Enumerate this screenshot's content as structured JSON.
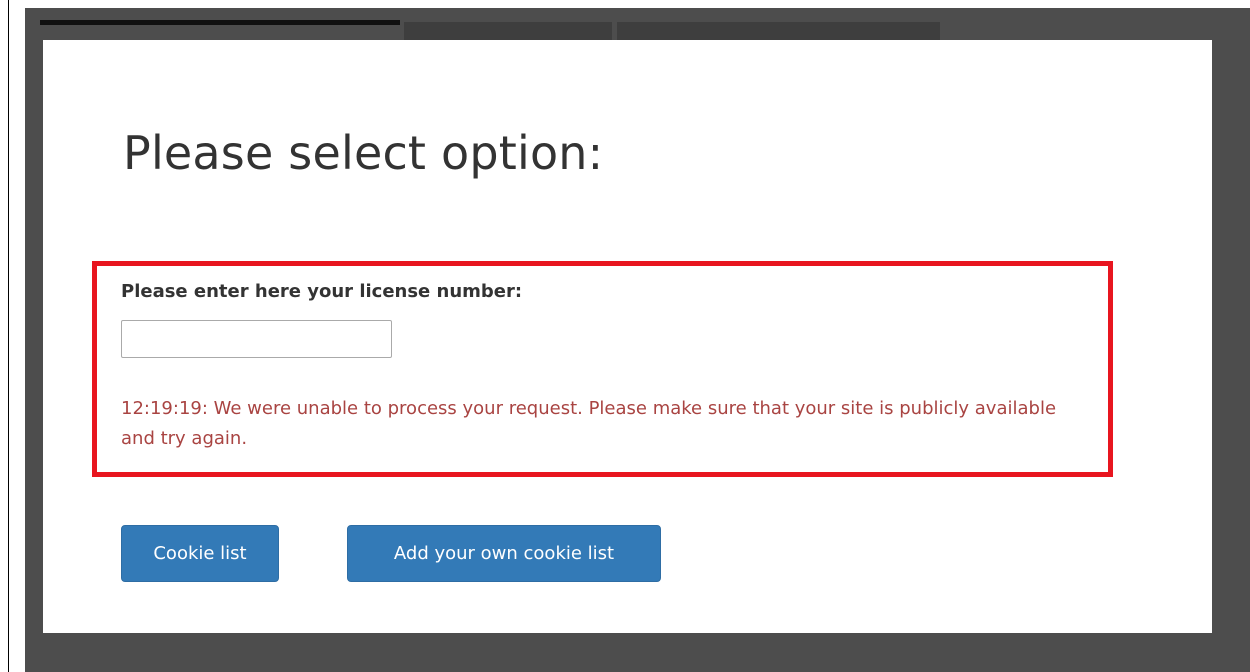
{
  "dialog": {
    "title": "Please select option:",
    "license": {
      "label": "Please enter here your license number:",
      "value": "",
      "placeholder": ""
    },
    "error_message": "12:19:19: We were unable to process your request. Please make sure that your site is publicly available and try again.",
    "buttons": {
      "cookie_list": "Cookie list",
      "add_own_cookie_list": "Add your own cookie list"
    }
  },
  "colors": {
    "backdrop": "#4d4d4d",
    "primary_button": "#337ab7",
    "error_text": "#a94442",
    "highlight_border": "#e8151f"
  }
}
